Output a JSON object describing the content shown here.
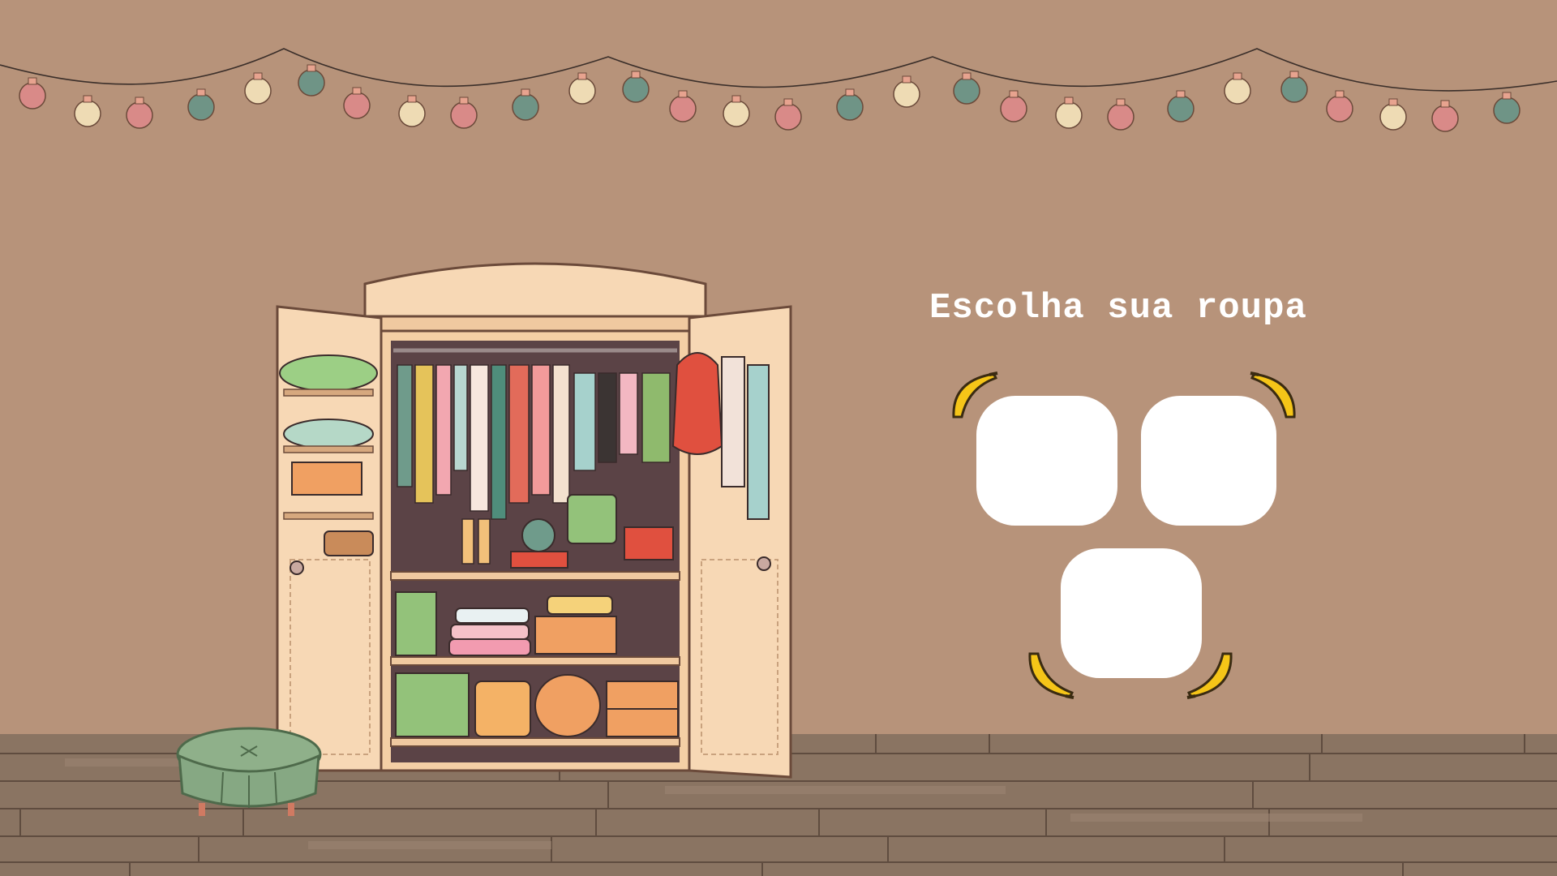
{
  "title": "Escolha sua roupa",
  "outfit_slots": [
    {
      "id": "slot-1",
      "content": ""
    },
    {
      "id": "slot-2",
      "content": ""
    },
    {
      "id": "slot-3",
      "content": ""
    }
  ],
  "colors": {
    "wall": "#b7937a",
    "floor": "#8a7462",
    "slot": "#ffffff",
    "title": "#ffffff",
    "bulb_pink": "#d98a88",
    "bulb_cream": "#eedbb4",
    "bulb_teal": "#6f9486",
    "banana": "#f5c518"
  },
  "icons": {
    "banana": "banana-icon",
    "wardrobe": "wardrobe-illustration",
    "ottoman": "ottoman-illustration",
    "lights": "string-lights"
  }
}
